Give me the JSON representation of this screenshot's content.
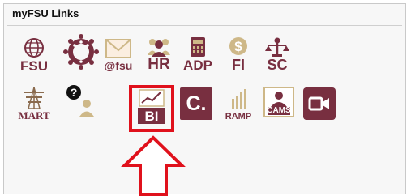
{
  "panel": {
    "title": "myFSU Links"
  },
  "links": [
    {
      "id": "fsu",
      "caption": "FSU",
      "icon": "globe-icon"
    },
    {
      "id": "canvas",
      "caption": "",
      "icon": "canvas-dots-icon"
    },
    {
      "id": "mail",
      "caption": "@fsu",
      "icon": "envelope-icon"
    },
    {
      "id": "hr",
      "caption": "HR",
      "icon": "people-icon"
    },
    {
      "id": "adp",
      "caption": "ADP",
      "icon": "calculator-icon"
    },
    {
      "id": "fi",
      "caption": "FI",
      "icon": "dollar-icon"
    },
    {
      "id": "sc",
      "caption": "SC",
      "icon": "scales-icon"
    },
    {
      "id": "mart",
      "caption": "MART",
      "icon": "tower-icon"
    },
    {
      "id": "help",
      "caption": "",
      "icon": "help-person-icon"
    },
    {
      "id": "bi",
      "caption": "BI",
      "icon": "line-chart-icon"
    },
    {
      "id": "c",
      "caption": "C.",
      "icon": "c-logo-icon"
    },
    {
      "id": "ramp",
      "caption": "RAMP",
      "icon": "bars-icon"
    },
    {
      "id": "cams",
      "caption": "CAMS",
      "icon": "person-card-icon"
    },
    {
      "id": "video",
      "caption": "",
      "icon": "video-camera-icon"
    }
  ],
  "colors": {
    "garnet": "#782f40",
    "gold": "#ceb888",
    "highlight": "#e0111c",
    "panel_bg": "#f7f7f7"
  }
}
